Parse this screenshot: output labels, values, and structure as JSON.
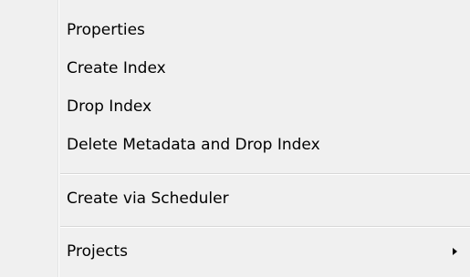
{
  "context_menu": {
    "items": [
      {
        "label": "Properties"
      },
      {
        "label": "Create Index"
      },
      {
        "label": "Drop Index"
      },
      {
        "label": "Delete Metadata and Drop Index"
      },
      {
        "label": "Create via Scheduler"
      },
      {
        "label": "Projects",
        "submenu_icon": "chevron-right-icon"
      }
    ]
  }
}
